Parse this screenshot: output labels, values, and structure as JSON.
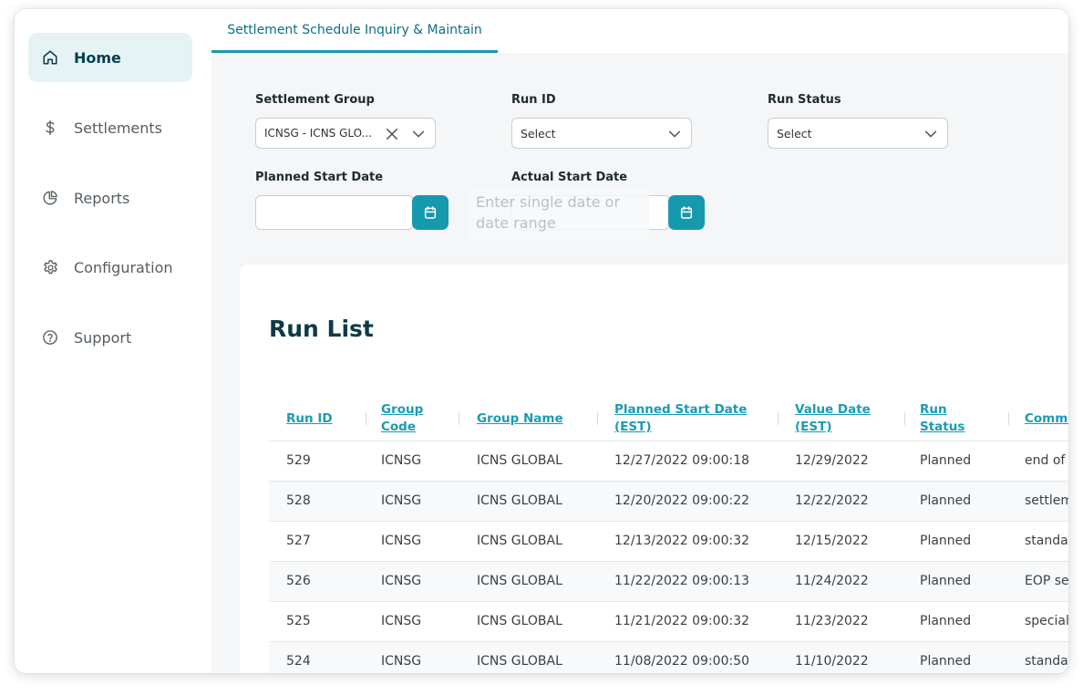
{
  "sidebar": {
    "items": [
      {
        "label": "Home",
        "icon": "home-icon",
        "active": true
      },
      {
        "label": "Settlements",
        "icon": "dollar-icon"
      },
      {
        "label": "Reports",
        "icon": "pie-chart-icon"
      },
      {
        "label": "Configuration",
        "icon": "gear-icon"
      },
      {
        "label": "Support",
        "icon": "help-circle-icon"
      }
    ]
  },
  "tab": {
    "label": "Settlement Schedule Inquiry & Maintain"
  },
  "filters": {
    "settlement_group": {
      "label": "Settlement Group",
      "value": "ICNSG - ICNS GLO..."
    },
    "run_id": {
      "label": "Run ID",
      "value": "Select"
    },
    "run_status": {
      "label": "Run Status",
      "value": "Select"
    },
    "planned_start_date": {
      "label": "Planned Start Date",
      "value": ""
    },
    "actual_start_date": {
      "label": "Actual Start Date",
      "value": ""
    },
    "date_tooltip": "Enter single date or date range"
  },
  "run_list": {
    "title": "Run List",
    "columns": {
      "run_id": "Run ID",
      "group_code_1": "Group",
      "group_code_2": "Code",
      "group_name": "Group Name",
      "planned_start_1": "Planned Start Date",
      "planned_start_2": "(EST)",
      "value_date_1": "Value Date",
      "value_date_2": "(EST)",
      "run_status_1": "Run",
      "run_status_2": "Status",
      "comments": "Comme"
    },
    "rows": [
      {
        "run_id": "529",
        "group_code": "ICNSG",
        "group_name": "ICNS GLOBAL",
        "planned_start": "12/27/2022 09:00:18",
        "value_date": "12/29/2022",
        "status": "Planned",
        "comment": "end of"
      },
      {
        "run_id": "528",
        "group_code": "ICNSG",
        "group_name": "ICNS GLOBAL",
        "planned_start": "12/20/2022 09:00:22",
        "value_date": "12/22/2022",
        "status": "Planned",
        "comment": "settlem"
      },
      {
        "run_id": "527",
        "group_code": "ICNSG",
        "group_name": "ICNS GLOBAL",
        "planned_start": "12/13/2022 09:00:32",
        "value_date": "12/15/2022",
        "status": "Planned",
        "comment": "standa"
      },
      {
        "run_id": "526",
        "group_code": "ICNSG",
        "group_name": "ICNS GLOBAL",
        "planned_start": "11/22/2022 09:00:13",
        "value_date": "11/24/2022",
        "status": "Planned",
        "comment": "EOP se"
      },
      {
        "run_id": "525",
        "group_code": "ICNSG",
        "group_name": "ICNS GLOBAL",
        "planned_start": "11/21/2022 09:00:32",
        "value_date": "11/23/2022",
        "status": "Planned",
        "comment": "special"
      },
      {
        "run_id": "524",
        "group_code": "ICNSG",
        "group_name": "ICNS GLOBAL",
        "planned_start": "11/08/2022 09:00:50",
        "value_date": "11/10/2022",
        "status": "Planned",
        "comment": "standa"
      }
    ]
  },
  "colors": {
    "accent": "#1799ad",
    "title": "#0e3a47",
    "active_nav_bg": "#e6f3f5"
  }
}
